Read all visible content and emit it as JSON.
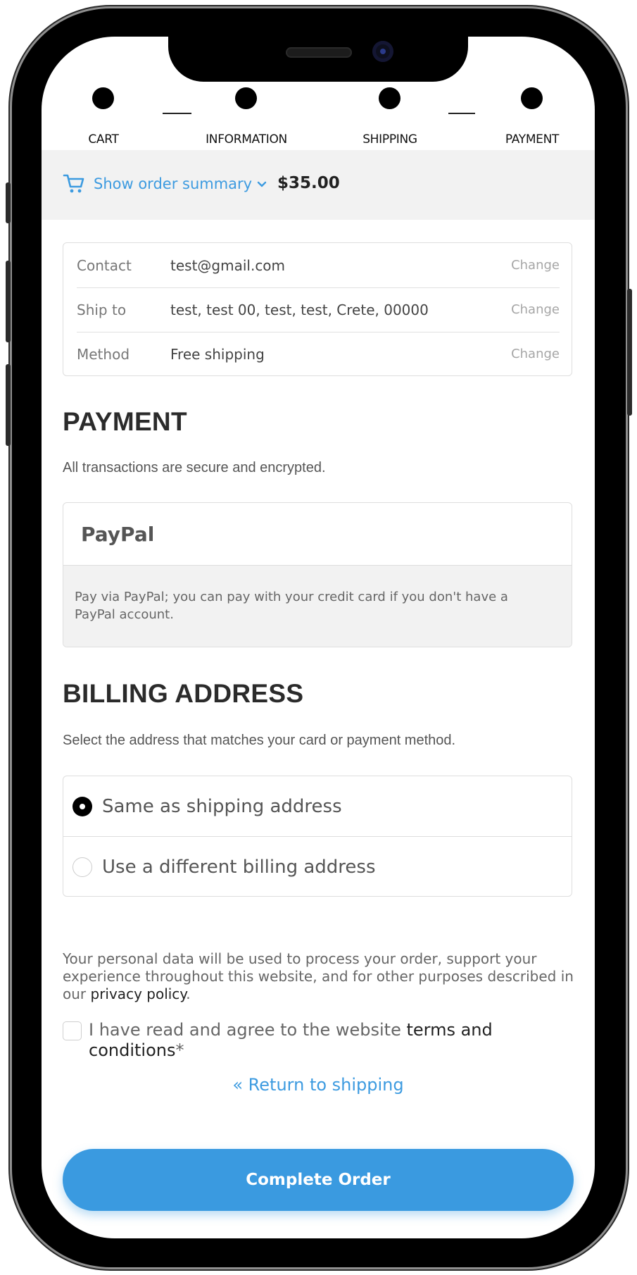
{
  "steps": [
    {
      "label": "CART"
    },
    {
      "label": "INFORMATION"
    },
    {
      "label": "SHIPPING"
    },
    {
      "label": "PAYMENT"
    }
  ],
  "summary": {
    "toggle_label": "Show order summary",
    "total": "$35.00"
  },
  "review": {
    "rows": [
      {
        "label": "Contact",
        "value": "test@gmail.com",
        "action": "Change"
      },
      {
        "label": "Ship to",
        "value": "test, test 00, test, test, Crete, 00000",
        "action": "Change"
      },
      {
        "label": "Method",
        "value": "Free shipping",
        "action": "Change"
      }
    ]
  },
  "payment": {
    "title": "PAYMENT",
    "subtitle": "All transactions are secure and encrypted.",
    "method_name": "PayPal",
    "method_description": "Pay via PayPal; you can pay with your credit card if you don't have a PayPal account."
  },
  "billing": {
    "title": "BILLING ADDRESS",
    "subtitle": "Select the address that matches your card or payment method.",
    "options": [
      {
        "label": "Same as shipping address",
        "selected": true
      },
      {
        "label": "Use a different billing address",
        "selected": false
      }
    ]
  },
  "privacy": {
    "text": "Your personal data will be used to process your order, support your experience throughout this website, and for other purposes described in our ",
    "link": "privacy policy",
    "end": "."
  },
  "terms": {
    "text": "I have read and agree to the website ",
    "link": "terms and conditions",
    "required_mark": "*",
    "checked": false
  },
  "return_link": "« Return to shipping",
  "complete_button": "Complete Order",
  "colors": {
    "accent": "#3a9ae0",
    "link_blue": "#3d9be0",
    "summary_bg": "#f2f2f2"
  }
}
